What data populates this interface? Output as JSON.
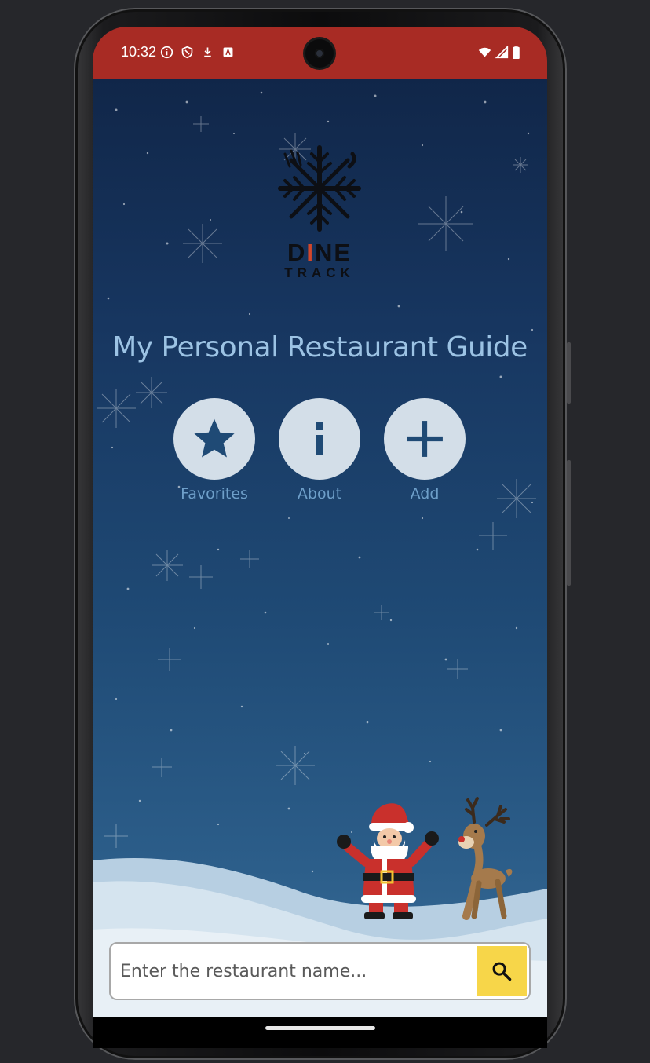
{
  "status_bar": {
    "time": "10:32",
    "left_icons": [
      "info-icon",
      "shield-icon",
      "download-icon",
      "a-icon"
    ],
    "right_icons": [
      "wifi-icon",
      "signal-icon",
      "battery-icon"
    ],
    "color": "#a82b24"
  },
  "logo": {
    "word_top": "DINE",
    "word_bottom": "TRACK"
  },
  "main": {
    "title": "My Personal Restaurant Guide",
    "actions": [
      {
        "label": "Favorites",
        "icon": "star-icon"
      },
      {
        "label": "About",
        "icon": "info-icon"
      },
      {
        "label": "Add",
        "icon": "plus-icon"
      }
    ]
  },
  "search": {
    "placeholder": "Enter the restaurant name...",
    "value": "",
    "button_icon": "search-icon",
    "button_color": "#f7d649"
  },
  "colors": {
    "accent_title": "#9cc3e4",
    "action_circle": "#d3dee8",
    "action_icon": "#1f4a75"
  }
}
